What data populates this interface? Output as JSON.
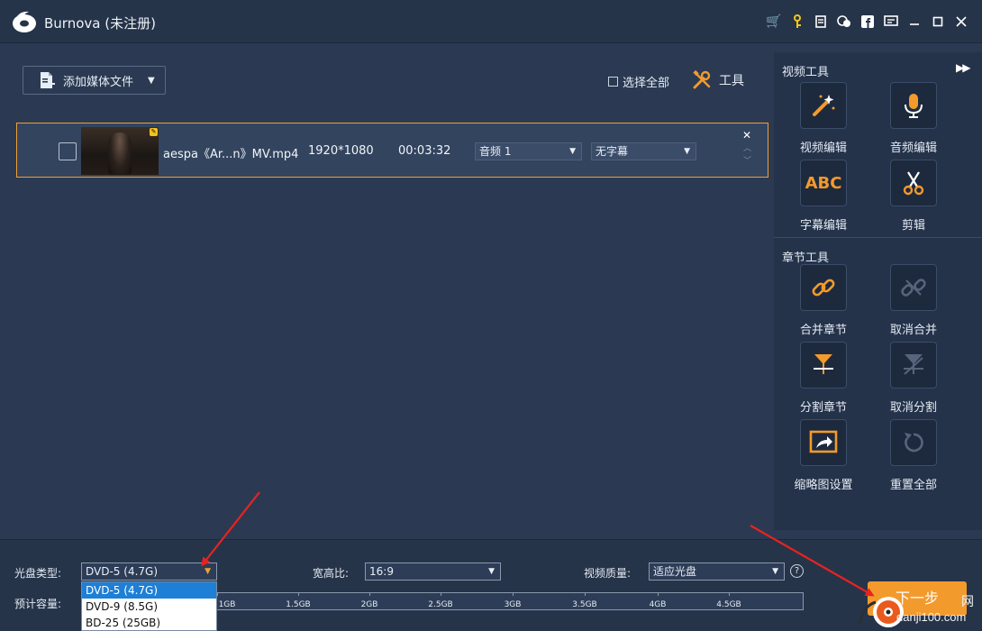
{
  "titlebar": {
    "title": "Burnova (未注册)",
    "icons": [
      "cart-icon",
      "key-icon",
      "document-icon",
      "chat-icon",
      "facebook-icon",
      "feedback-icon",
      "minimize-icon",
      "maximize-icon",
      "close-icon"
    ]
  },
  "toolbar": {
    "add_media_label": "添加媒体文件",
    "select_all_label": "选择全部",
    "tools_label": "工具"
  },
  "media_row": {
    "filename": "aespa《Ar...n》MV.mp4",
    "resolution": "1920*1080",
    "duration": "00:03:32",
    "audio_track": "音频 1",
    "subtitle": "无字幕"
  },
  "panel": {
    "video_tools_title": "视频工具",
    "chapter_tools_title": "章节工具",
    "video_tools": [
      {
        "label": "视频编辑",
        "icon": "magic-wand-icon"
      },
      {
        "label": "音频编辑",
        "icon": "microphone-icon"
      },
      {
        "label": "字幕编辑",
        "icon": "abc-text-icon",
        "glyph": "ABC"
      },
      {
        "label": "剪辑",
        "icon": "scissors-icon"
      }
    ],
    "chapter_tools": [
      {
        "label": "合并章节",
        "icon": "link-icon"
      },
      {
        "label": "取消合并",
        "icon": "unlink-icon"
      },
      {
        "label": "分割章节",
        "icon": "split-icon"
      },
      {
        "label": "取消分割",
        "icon": "unsplit-icon"
      },
      {
        "label": "缩略图设置",
        "icon": "thumbnail-icon"
      },
      {
        "label": "重置全部",
        "icon": "reset-icon"
      }
    ]
  },
  "bottom": {
    "disc_type_label": "光盘类型:",
    "disc_type_value": "DVD-5 (4.7G)",
    "disc_options": [
      "DVD-5 (4.7G)",
      "DVD-9 (8.5G)",
      "BD-25 (25GB)"
    ],
    "aspect_label": "宽高比:",
    "aspect_value": "16:9",
    "quality_label": "视频质量:",
    "quality_value": "适应光盘",
    "capacity_label": "预计容量:",
    "capacity_ticks": [
      "1GB",
      "1.5GB",
      "2GB",
      "2.5GB",
      "3GB",
      "3.5GB",
      "4GB",
      "4.5GB"
    ],
    "help_glyph": "?",
    "next_label": "下一步"
  },
  "watermark": {
    "site": "danji100.com",
    "char": "网"
  },
  "colors": {
    "accent": "#f39a2c",
    "background": "#2b3a52",
    "selection": "#1e7fd6",
    "annotation_arrow": "#e8231f"
  }
}
